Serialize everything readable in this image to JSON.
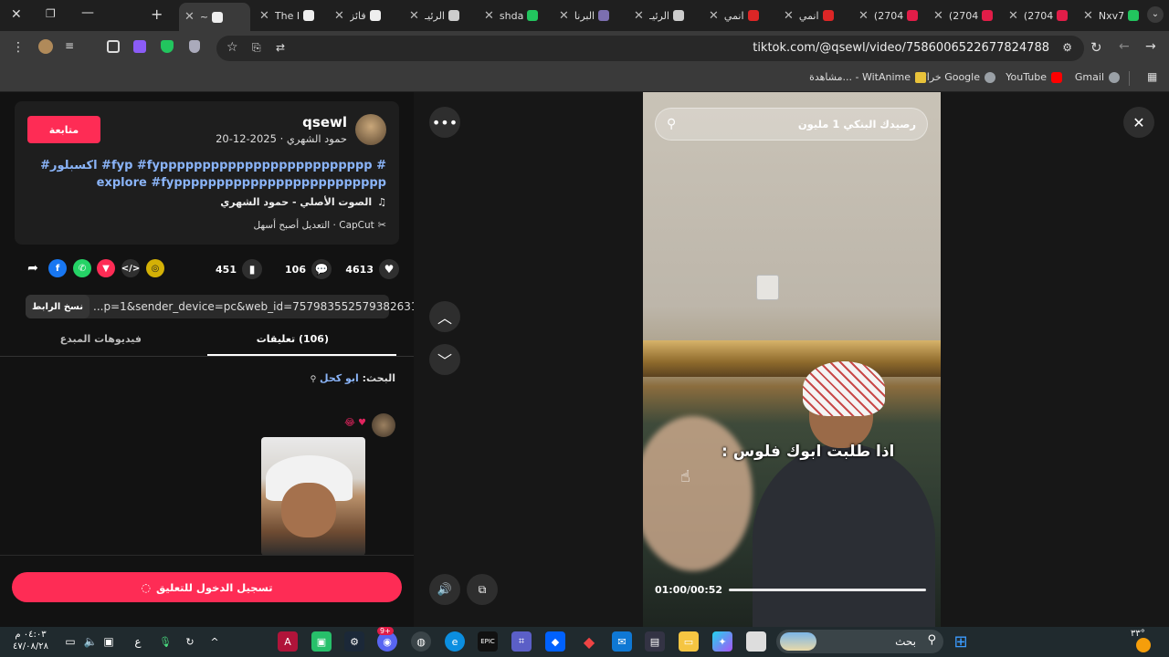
{
  "browser": {
    "tabs": [
      {
        "label": "Nxv7",
        "color": "#22c55e"
      },
      {
        "label": "(2704",
        "color": "#e11d48"
      },
      {
        "label": "(2704",
        "color": "#e11d48"
      },
      {
        "label": "(2704",
        "color": "#e11d48"
      },
      {
        "label": "انمي",
        "color": "#dc2626"
      },
      {
        "label": "انمي",
        "color": "#dc2626"
      },
      {
        "label": "الرئيـ",
        "color": "#cccccc"
      },
      {
        "label": "البرنا",
        "color": "#7c6fb0"
      },
      {
        "label": "shda",
        "color": "#22c55e"
      },
      {
        "label": "الرئيـ",
        "color": "#cccccc"
      },
      {
        "label": "فائز",
        "color": "#eeeeee"
      },
      {
        "label": "The I",
        "color": "#eeeeee"
      },
      {
        "label": "~",
        "color": "#eeeeee"
      }
    ],
    "url": "tiktok.com/@qsewl/video/7586006522677824788",
    "bookmarks": [
      {
        "label": "Gmail",
        "color": "#ea4335"
      },
      {
        "label": "YouTube",
        "color": "#ff0000"
      },
      {
        "label": "خرائط Google",
        "color": "#aaaaaa"
      },
      {
        "label": "مشاهدة... - WitAnime",
        "color": "#f59e0b"
      }
    ]
  },
  "post": {
    "follow_label": "متابعة",
    "username": "qsewl",
    "meta": "حمود الشهري · 2025-12-20",
    "hashtags": "#اكسبلور #fyp #fyppppppppppppppppppppppppp #explore #fyppppppppppppppppppppppppp",
    "music": "الصوت الأصلي - حمود الشهري",
    "capcut": "CapCut · التعديل أصبح أسهل",
    "likes": "4613",
    "comments": "106",
    "saves": "451",
    "link": "...p=1&sender_device=pc&web_id=7579835525793826311",
    "copy_label": "نسخ الرابط",
    "tab_comments": "(106) تعليقات",
    "tab_videos": "فيديوهات المبدع",
    "search_prefix": "البحث:",
    "search_keyword": "ابو كحل",
    "comment_emojis": "♥ 😂",
    "login_label": "تسجيل الدخول للتعليق"
  },
  "video": {
    "search_text": "رصيدك البنكي 1 مليون",
    "caption": "اذا طلبت ابوك فلوس :",
    "time": "01:00/00:52",
    "progress": 0.98
  },
  "taskbar": {
    "search_label": "بحث",
    "time": "٠٤:٠٣ م",
    "date": "٤٧/٠٨/٢٨",
    "lang": "ع",
    "weather": "٣٣°",
    "discord_badge": "9+"
  }
}
